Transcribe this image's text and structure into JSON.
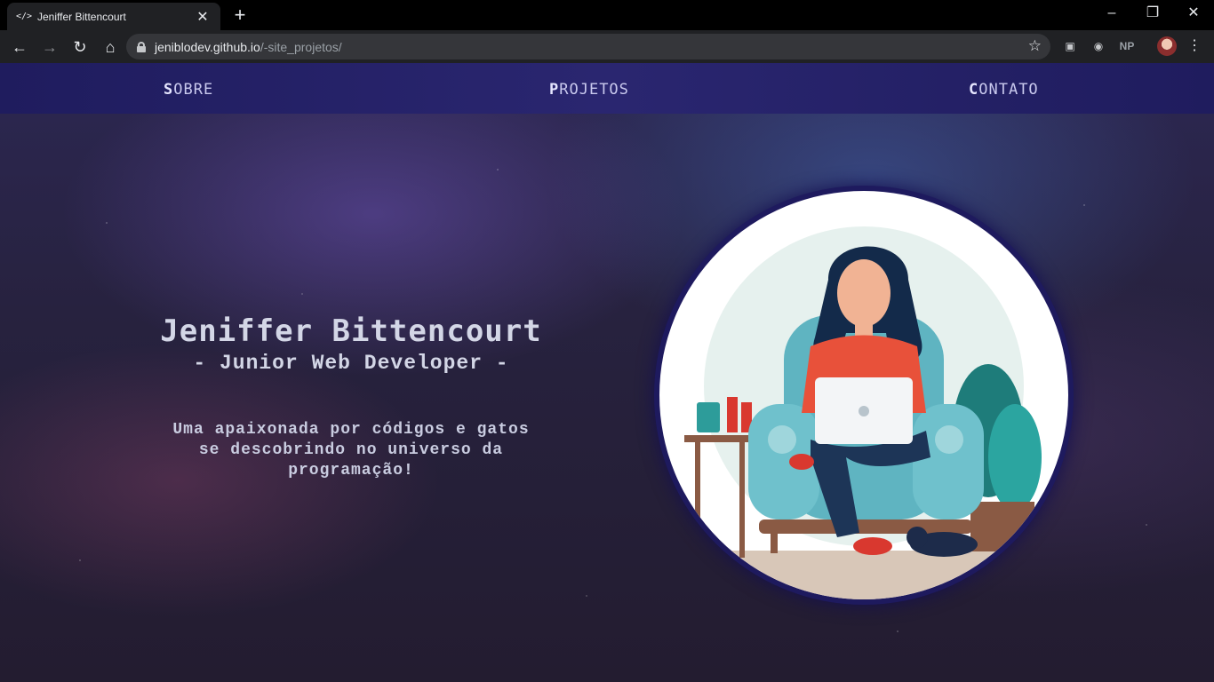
{
  "browser": {
    "tab_title": "Jeniffer Bittencourt",
    "tab_favicon": "</>",
    "url_host": "jeniblodev.github.io",
    "url_path": "/-site_projetos/",
    "extensions": [
      "NP"
    ]
  },
  "nav": {
    "items": [
      {
        "first": "S",
        "rest": "OBRE"
      },
      {
        "first": "P",
        "rest": "ROJETOS"
      },
      {
        "first": "C",
        "rest": "ONTATO"
      }
    ]
  },
  "hero": {
    "name": "Jeniffer Bittencourt",
    "role": "- Junior Web Developer -",
    "tagline_lines": [
      "Uma apaixonada por códigos e gatos",
      "se descobrindo no universo da",
      "programação!"
    ]
  },
  "colors": {
    "nav_bg": "#2a2670",
    "nav_text": "#c9c9ee",
    "ring": "#1e1a5e"
  }
}
